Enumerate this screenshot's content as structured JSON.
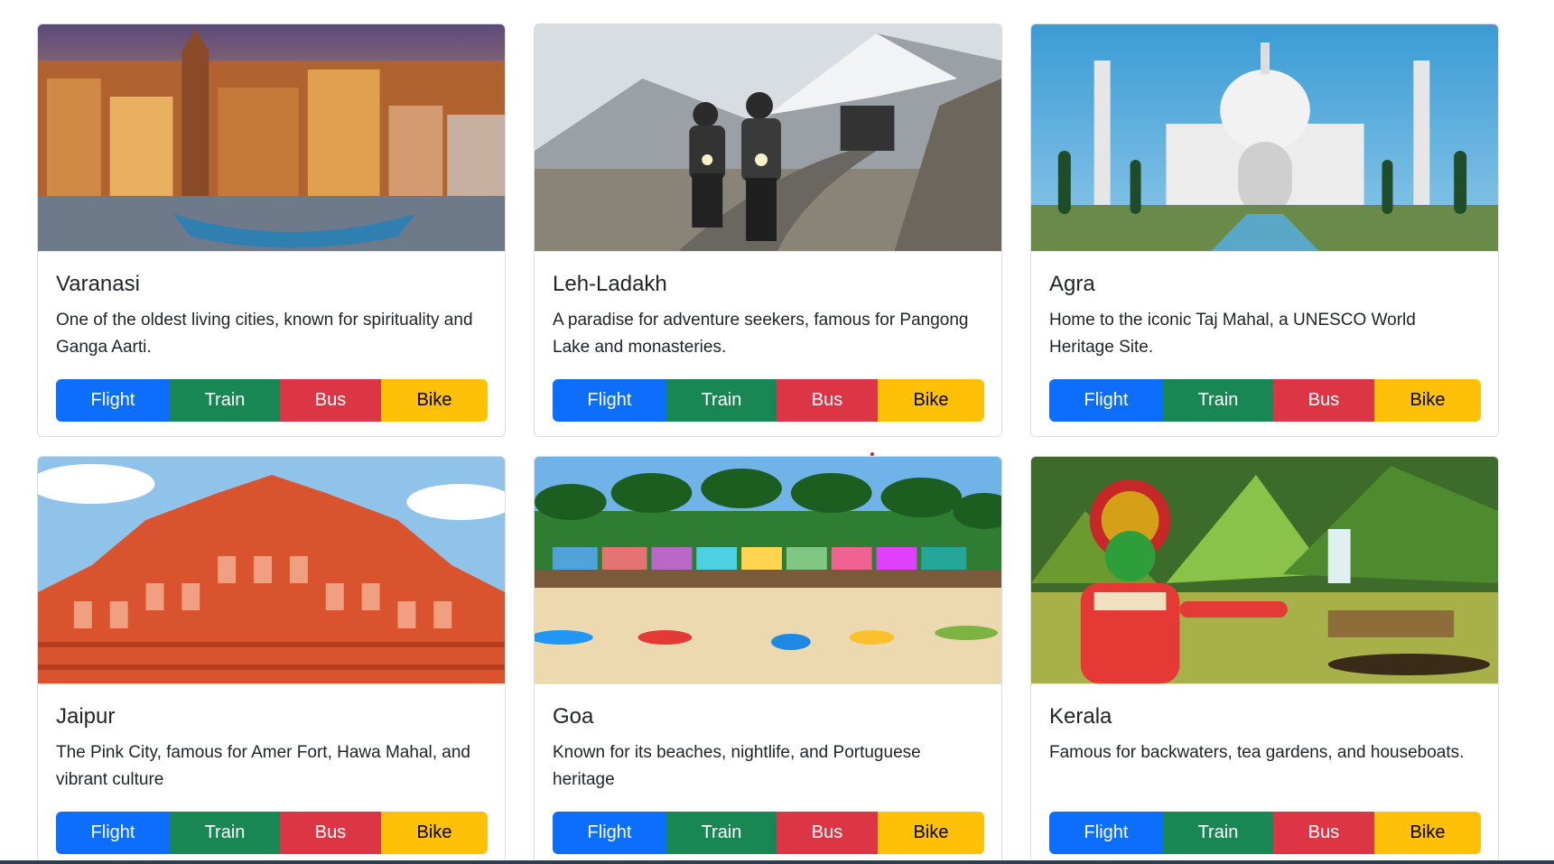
{
  "colors": {
    "flight": "#0d6efd",
    "train": "#198754",
    "bus": "#dc3545",
    "bike": "#ffc107"
  },
  "destinations": [
    {
      "title": "Varanasi",
      "description": "One of the oldest living cities, known for spirituality and Ganga Aarti.",
      "image": "ghats-riverside-photo",
      "buttons": {
        "flight": "Flight",
        "train": "Train",
        "bus": "Bus",
        "bike": "Bike"
      }
    },
    {
      "title": "Leh-Ladakh",
      "description": "A paradise for adventure seekers, famous for Pangong Lake and monasteries.",
      "image": "mountain-bikers-photo",
      "buttons": {
        "flight": "Flight",
        "train": "Train",
        "bus": "Bus",
        "bike": "Bike"
      }
    },
    {
      "title": "Agra",
      "description": "Home to the iconic Taj Mahal, a UNESCO World Heritage Site.",
      "image": "taj-mahal-photo",
      "buttons": {
        "flight": "Flight",
        "train": "Train",
        "bus": "Bus",
        "bike": "Bike"
      }
    },
    {
      "title": "Jaipur",
      "description": "The Pink City, famous for Amer Fort, Hawa Mahal, and vibrant culture",
      "image": "hawa-mahal-photo",
      "buttons": {
        "flight": "Flight",
        "train": "Train",
        "bus": "Bus",
        "bike": "Bike"
      }
    },
    {
      "title": "Goa",
      "description": "Known for its beaches, nightlife, and Portuguese heritage",
      "image": "beach-kayaks-photo",
      "buttons": {
        "flight": "Flight",
        "train": "Train",
        "bus": "Bus",
        "bike": "Bike"
      }
    },
    {
      "title": "Kerala",
      "description": "Famous for backwaters, tea gardens, and houseboats.",
      "image": "kathakali-backwaters-photo",
      "buttons": {
        "flight": "Flight",
        "train": "Train",
        "bus": "Bus",
        "bike": "Bike"
      }
    }
  ]
}
